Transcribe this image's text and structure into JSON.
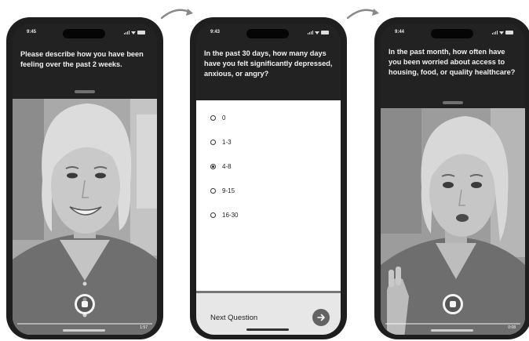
{
  "screens": [
    {
      "time": "9:45",
      "question": "Please describe how you have been feeling over the past 2 weeks.",
      "mode": "video-recording",
      "video_subject": "smiling woman",
      "record_timer": "1:57"
    },
    {
      "time": "9:43",
      "question": "In the past 30 days, how many days have you felt significantly depressed, anxious, or angry?",
      "mode": "multiple-choice",
      "options": [
        "0",
        "1-3",
        "4-8",
        "9-15",
        "16-30"
      ],
      "selected_option": "4-8",
      "next_label": "Next Question",
      "next_icon": "arrow-right-icon"
    },
    {
      "time": "9:44",
      "question": "In the past month, how often have you been worried about access to housing, food, or quality healthcare?",
      "mode": "video-recording",
      "video_subject": "speaking woman",
      "record_timer": "0:08"
    }
  ],
  "colors": {
    "phone_frame": "#1e1e1e",
    "header_bg": "#222222",
    "question_text": "#f2f2f2",
    "answers_bg": "#ffffff",
    "footer_bg": "#e7e7e7",
    "next_button": "#636363"
  }
}
